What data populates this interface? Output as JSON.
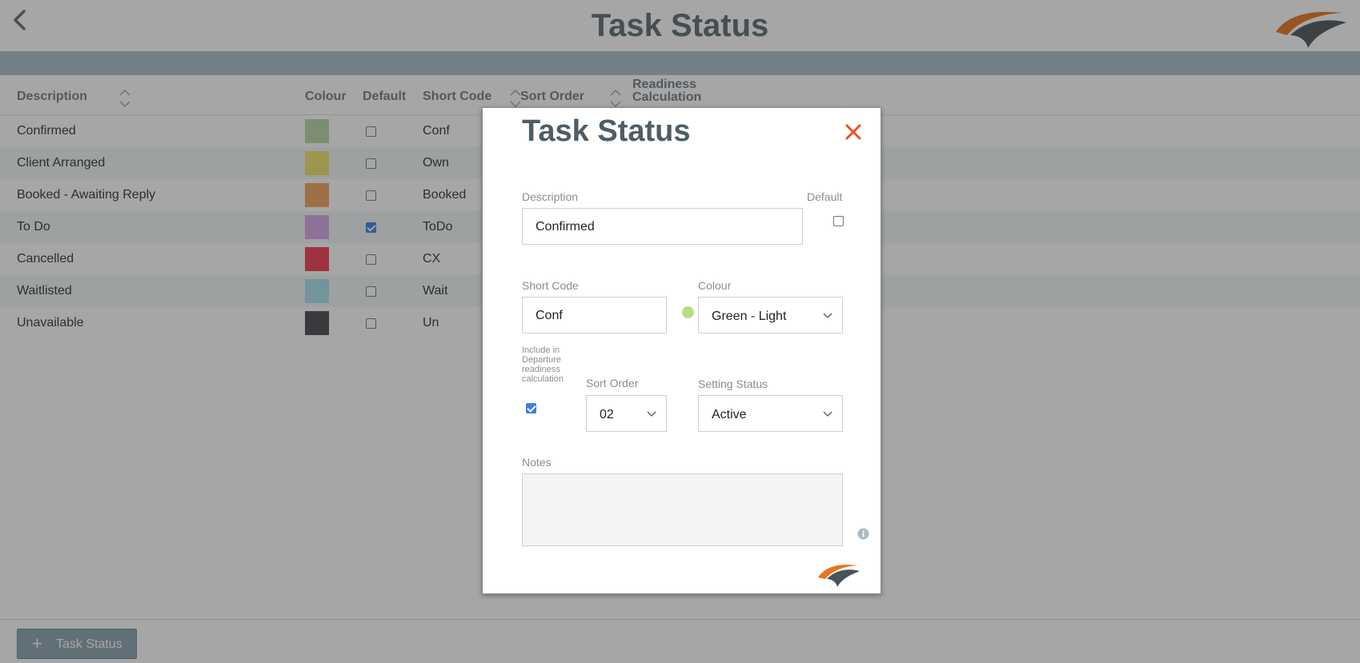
{
  "page": {
    "title": "Task Status",
    "icons": {
      "back": "chevron-left-icon",
      "logo": "brand-swoosh-logo"
    }
  },
  "table": {
    "headers": {
      "description": "Description",
      "colour": "Colour",
      "default": "Default",
      "short_code": "Short Code",
      "sort_order": "Sort Order",
      "readiness_line1": "Readiness",
      "readiness_line2": "Calculation"
    },
    "rows": [
      {
        "description": "Confirmed",
        "colour": "#b8d6a6",
        "default": false,
        "short_code": "Conf"
      },
      {
        "description": "Client Arranged",
        "colour": "#f0e26a",
        "default": false,
        "short_code": "Own"
      },
      {
        "description": "Booked - Awaiting Reply",
        "colour": "#f0a45c",
        "default": false,
        "short_code": "Booked"
      },
      {
        "description": "To Do",
        "colour": "#d6a6e8",
        "default": true,
        "short_code": "ToDo"
      },
      {
        "description": "Cancelled",
        "colour": "#f03c4c",
        "default": false,
        "short_code": "CX"
      },
      {
        "description": "Waitlisted",
        "colour": "#a8e0ec",
        "default": false,
        "short_code": "Wait"
      },
      {
        "description": "Unavailable",
        "colour": "#48464e",
        "default": false,
        "short_code": "Un"
      }
    ]
  },
  "footer": {
    "add_label": "Task Status",
    "add_icon": "plus-icon"
  },
  "modal": {
    "title": "Task Status",
    "close_icon": "close-icon",
    "description_label": "Description",
    "description_value": "Confirmed",
    "default_label": "Default",
    "default_checked": false,
    "short_code_label": "Short Code",
    "short_code_value": "Conf",
    "colour_label": "Colour",
    "colour_value": "Green - Light",
    "colour_dot": "#b8dc8a",
    "readiness_label": "Include in Departure readiness calculation",
    "readiness_checked": true,
    "sort_order_label": "Sort Order",
    "sort_order_value": "02",
    "setting_status_label": "Setting Status",
    "setting_status_value": "Active",
    "notes_label": "Notes",
    "notes_value": "",
    "info_icon": "info-icon"
  },
  "colors": {
    "accent_close": "#e8531f",
    "title": "#4e5d66",
    "header_bar": "#a9bfca",
    "checkbox": "#3c7fe0"
  }
}
